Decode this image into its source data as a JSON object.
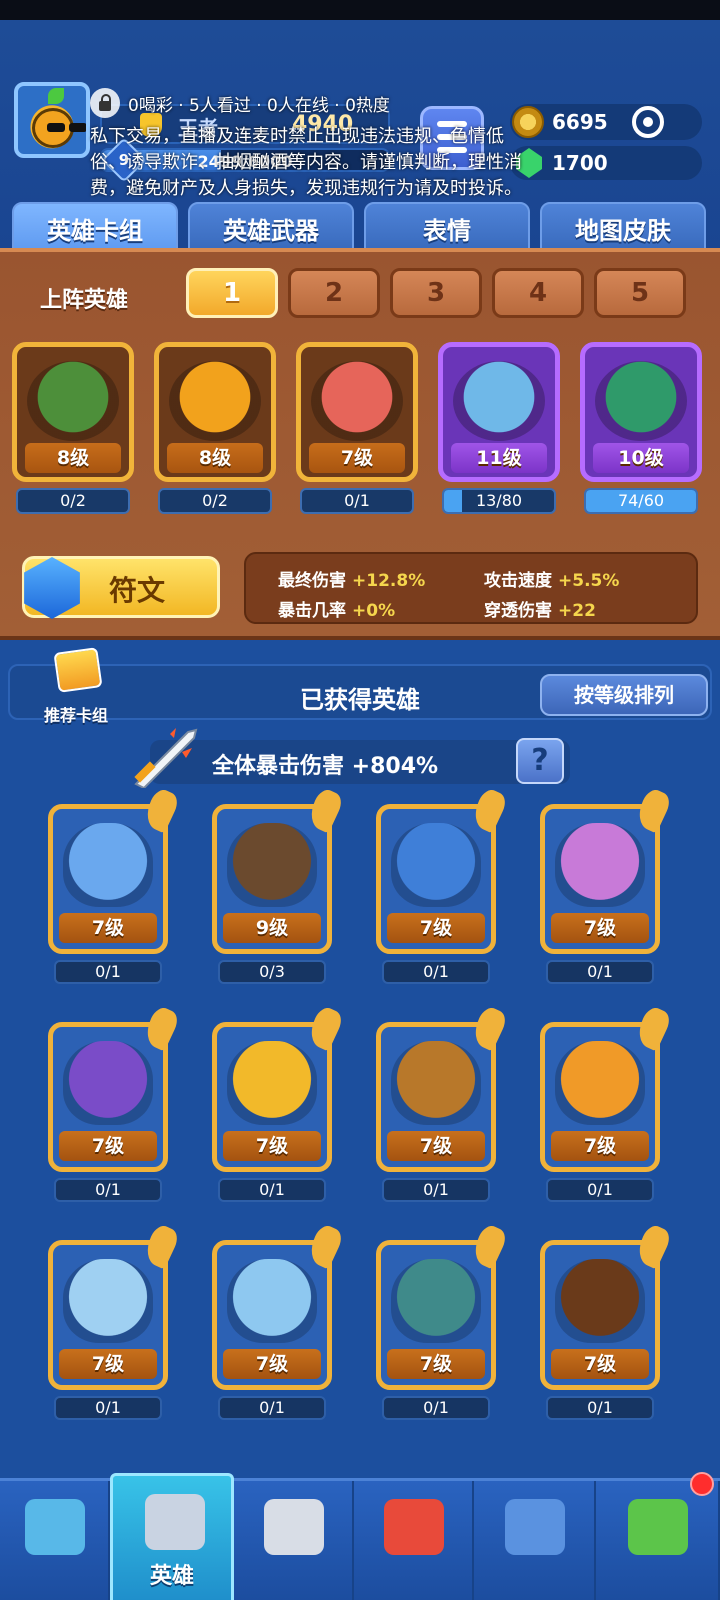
{
  "header": {
    "rank_label": "王者",
    "trophies": "4940",
    "level": "9",
    "xp_text": "2499/6000",
    "xp_fraction": 0.4165,
    "coins": "6695",
    "gems": "1700"
  },
  "live_overlay": {
    "stats": "0喝彩 · 5人看过 · 0人在线 · 0热度",
    "notice": "私下交易，直播及连麦时禁止出现违法违规、色情低俗、诱导欺诈、抽烟酗酒等内容。请谨慎判断，理性消费，避免财产及人身损失，发现违规行为请及时投诉。"
  },
  "tabs": [
    "英雄卡组",
    "英雄武器",
    "表情",
    "地图皮肤"
  ],
  "deck": {
    "title": "上阵英雄",
    "slots": [
      "1",
      "2",
      "3",
      "4",
      "5"
    ],
    "active_slot": 0,
    "heroes": [
      {
        "level": "8级",
        "progress": "0/2",
        "rarity": "rare",
        "color": "#4d8f3a"
      },
      {
        "level": "8级",
        "progress": "0/2",
        "rarity": "rare",
        "color": "#f2a21c"
      },
      {
        "level": "7级",
        "progress": "0/1",
        "rarity": "rare",
        "color": "#e6655a"
      },
      {
        "level": "11级",
        "progress": "13/80",
        "rarity": "epic",
        "color": "#6fb8e8",
        "fill": 0.1625
      },
      {
        "level": "10级",
        "progress": "74/60",
        "rarity": "epic",
        "color": "#2f9a6a",
        "fill": 1.0
      }
    ],
    "rune_label": "符文",
    "stats": [
      {
        "key": "最终伤害",
        "value": "+12.8%"
      },
      {
        "key": "攻击速度",
        "value": "+5.5%"
      },
      {
        "key": "暴击几率",
        "value": "+0%"
      },
      {
        "key": "穿透伤害",
        "value": "+22"
      }
    ]
  },
  "collection": {
    "recommend_label": "推荐卡组",
    "title": "已获得英雄",
    "sort_label": "按等级排列",
    "crit_bonus": "全体暴击伤害 +804%",
    "help_label": "?",
    "heroes": [
      {
        "level": "7级",
        "progress": "0/1",
        "color": "#6aa8ee"
      },
      {
        "level": "9级",
        "progress": "0/3",
        "color": "#6b4a2e"
      },
      {
        "level": "7级",
        "progress": "0/1",
        "color": "#3f7fd8"
      },
      {
        "level": "7级",
        "progress": "0/1",
        "color": "#c87ad8"
      },
      {
        "level": "7级",
        "progress": "0/1",
        "color": "#7a4cc8"
      },
      {
        "level": "7级",
        "progress": "0/1",
        "color": "#f2b92a"
      },
      {
        "level": "7级",
        "progress": "0/1",
        "color": "#b8782a"
      },
      {
        "level": "7级",
        "progress": "0/1",
        "color": "#f09a28"
      },
      {
        "level": "7级",
        "progress": "0/1",
        "color": "#9fd0f2"
      },
      {
        "level": "7级",
        "progress": "0/1",
        "color": "#8ec8f0"
      },
      {
        "level": "7级",
        "progress": "0/1",
        "color": "#3f8a8a"
      },
      {
        "level": "7级",
        "progress": "0/1",
        "color": "#6a3a1a"
      }
    ]
  },
  "bottom_nav": [
    {
      "label": "",
      "icon": "treasure-chest-icon",
      "color": "#58b8e8"
    },
    {
      "label": "英雄",
      "icon": "knight-helmet-icon",
      "color": "#c9d3e2"
    },
    {
      "label": "",
      "icon": "crossed-swords-icon",
      "color": "#d8dde6"
    },
    {
      "label": "",
      "icon": "crown-shield-icon",
      "color": "#e84a3a"
    },
    {
      "label": "",
      "icon": "friends-icon",
      "color": "#5a92e0"
    },
    {
      "label": "",
      "icon": "sprout-garden-icon",
      "color": "#5cc54a"
    }
  ]
}
